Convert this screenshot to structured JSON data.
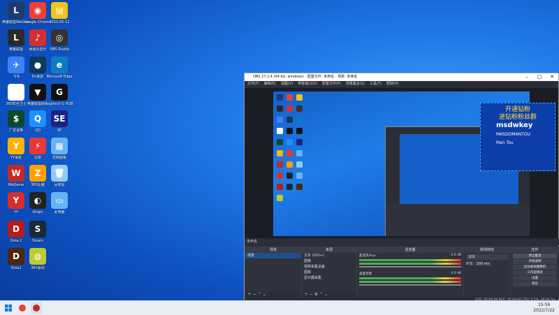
{
  "desktop_icons": [
    {
      "id": "i1",
      "label": "英雄联盟WeGame版",
      "color": "#1e3a6e",
      "glyph": "L"
    },
    {
      "id": "i2",
      "label": "Google Chrome",
      "color": "#e94235",
      "glyph": "◉"
    },
    {
      "id": "i3",
      "label": "2022-05-12",
      "color": "#f0c419",
      "glyph": "▤"
    },
    {
      "id": "i4",
      "label": "英雄联盟",
      "color": "#2a2a2a",
      "glyph": "L"
    },
    {
      "id": "i5",
      "label": "网易云音乐",
      "color": "#d32f2f",
      "glyph": "♪"
    },
    {
      "id": "i6",
      "label": "OBS Studio",
      "color": "#333",
      "glyph": "◎"
    },
    {
      "id": "i7",
      "label": "飞书",
      "color": "#3b82f6",
      "glyph": "✈"
    },
    {
      "id": "i8",
      "label": "Ev录屏",
      "color": "#0c3a5a",
      "glyph": "●"
    },
    {
      "id": "i9",
      "label": "Microsoft Edge",
      "color": "#0e7ac4",
      "glyph": "e"
    },
    {
      "id": "i10",
      "label": "360安全卫士",
      "color": "#fff",
      "glyph": "♦"
    },
    {
      "id": "i11",
      "label": "英雄联盟助手",
      "color": "#111",
      "glyph": "▼"
    },
    {
      "id": "i12",
      "label": "Logitech G HUB",
      "color": "#111",
      "glyph": "G"
    },
    {
      "id": "i13",
      "label": "广发证券",
      "color": "#0a4a2a",
      "glyph": "$"
    },
    {
      "id": "i14",
      "label": "QQ",
      "color": "#1e90ff",
      "glyph": "Q"
    },
    {
      "id": "i15",
      "label": "SE",
      "color": "#1a237e",
      "glyph": "SE"
    },
    {
      "id": "i16",
      "label": "YY语音",
      "color": "#ffb300",
      "glyph": "Y"
    },
    {
      "id": "i17",
      "label": "迅雷",
      "color": "#e53935",
      "glyph": "⚡"
    },
    {
      "id": "i18",
      "label": "控制面板",
      "color": "#64b5f6",
      "glyph": "▦"
    },
    {
      "id": "i19",
      "label": "WeGame",
      "color": "#c62828",
      "glyph": "W"
    },
    {
      "id": "i20",
      "label": "360压缩",
      "color": "#ffa000",
      "glyph": "Z"
    },
    {
      "id": "i21",
      "label": "回收站",
      "color": "#90caf9",
      "glyph": "🗑"
    },
    {
      "id": "i22",
      "label": "YY",
      "color": "#d32f2f",
      "glyph": "Y"
    },
    {
      "id": "i23",
      "label": "Origin",
      "color": "#222",
      "glyph": "◐"
    },
    {
      "id": "i24",
      "label": "此电脑",
      "color": "#64b5f6",
      "glyph": "▭"
    },
    {
      "id": "i25",
      "label": "Dota 2",
      "color": "#b71c1c",
      "glyph": "D"
    },
    {
      "id": "i26",
      "label": "Steam",
      "color": "#1b2838",
      "glyph": "S"
    },
    {
      "id": "i27",
      "label": "Dota2",
      "color": "#4a2a0a",
      "glyph": "D"
    },
    {
      "id": "i28",
      "label": "360驱动",
      "color": "#c0ca33",
      "glyph": "◍"
    }
  ],
  "taskbar": {
    "time": "15:59",
    "date": "2022/7/22"
  },
  "obs": {
    "title": "OBS 27.2.4 (64-bit, windows) - 配置文件: 未命名 - 场景: 未命名",
    "menu": [
      "文件(F)",
      "编辑(E)",
      "视图(V)",
      "停靠窗口(D)",
      "配置文件(P)",
      "场景集合(S)",
      "工具(T)",
      "帮助(H)"
    ],
    "scene_label": "未命名",
    "docks": {
      "scenes": {
        "title": "场景",
        "items": [
          "场景"
        ]
      },
      "sources": {
        "title": "来源",
        "items": [
          "文本 (GDI+)",
          "图像",
          "视频采集设备",
          "图像",
          "显示器采集"
        ]
      },
      "mixer": {
        "title": "混音器",
        "channels": [
          {
            "name": "麦克风/Aux",
            "db": "0.0 dB"
          },
          {
            "name": "桌面音频",
            "db": "0.0 dB"
          }
        ]
      },
      "transitions": {
        "title": "转场特效",
        "type": "淡出",
        "duration_label": "时长",
        "duration": "300 ms"
      },
      "controls": {
        "title": "控件",
        "buttons": [
          "停止推流",
          "开始录制",
          "启动虚拟摄像机",
          "工作室模式",
          "设置",
          "退出"
        ]
      }
    },
    "status": "LIVE: 00:00:00   REC: 00:00:00   CPU: 0.5%, 60.00 fps",
    "banner": {
      "line1": "开通钻粉",
      "line2": "进钻粉粉丝群",
      "wechat": "msdwkey",
      "tiktok": "MASDOMANTOU",
      "bilibili": "Man Tou"
    }
  }
}
